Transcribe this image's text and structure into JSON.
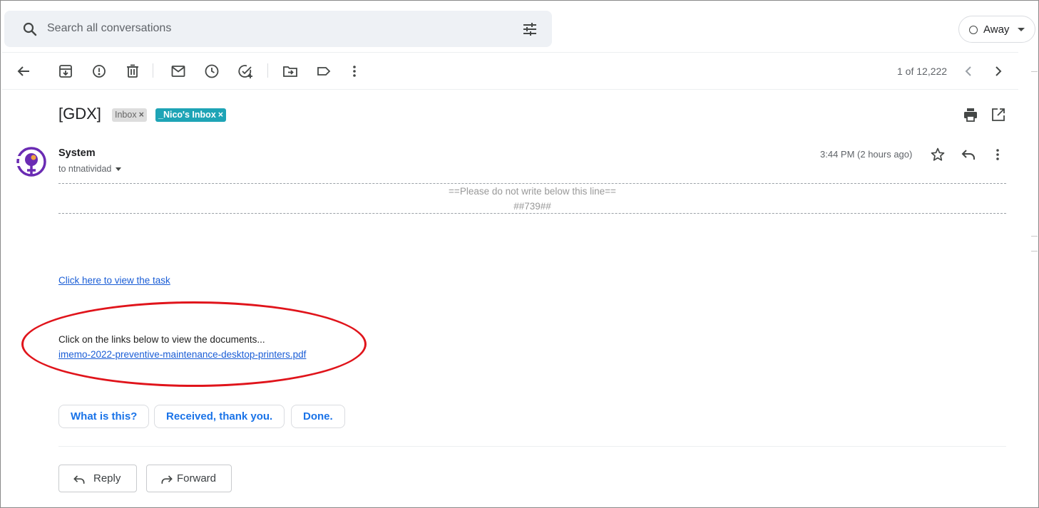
{
  "search": {
    "placeholder": "Search all conversations"
  },
  "status": {
    "label": "Away"
  },
  "toolbar": {
    "icons": [
      "back-arrow-icon",
      "archive-icon",
      "report-spam-icon",
      "delete-icon",
      "mark-unread-icon",
      "snooze-icon",
      "add-task-icon",
      "move-to-icon",
      "label-icon",
      "more-vert-icon"
    ]
  },
  "pager": {
    "count": "1 of 12,222"
  },
  "subject": {
    "title": "[GDX]",
    "labels": [
      {
        "text": "Inbox",
        "color": "#dddddd"
      },
      {
        "text": "_Nico's Inbox",
        "color": "#1ea4b6"
      }
    ],
    "remove_glyph": "×"
  },
  "message": {
    "sender": "System",
    "recipient": "to ntnatividad",
    "timestamp": "3:44 PM (2 hours ago)",
    "body": {
      "notice": "==Please do not write below this line==",
      "ticket": "##739##",
      "task_link": "Click here to view the task",
      "documents_intro": "Click on the links below to view the documents...",
      "document_link": "imemo-2022-preventive-maintenance-desktop-printers.pdf"
    }
  },
  "smart_replies": [
    "What is this?",
    "Received, thank you.",
    "Done."
  ],
  "actions": {
    "reply": "Reply",
    "forward": "Forward"
  },
  "colors": {
    "annotation": "#e0141b",
    "link": "#1a5dd6",
    "accent": "#1a73e8",
    "avatar": "#6a2bb3"
  }
}
